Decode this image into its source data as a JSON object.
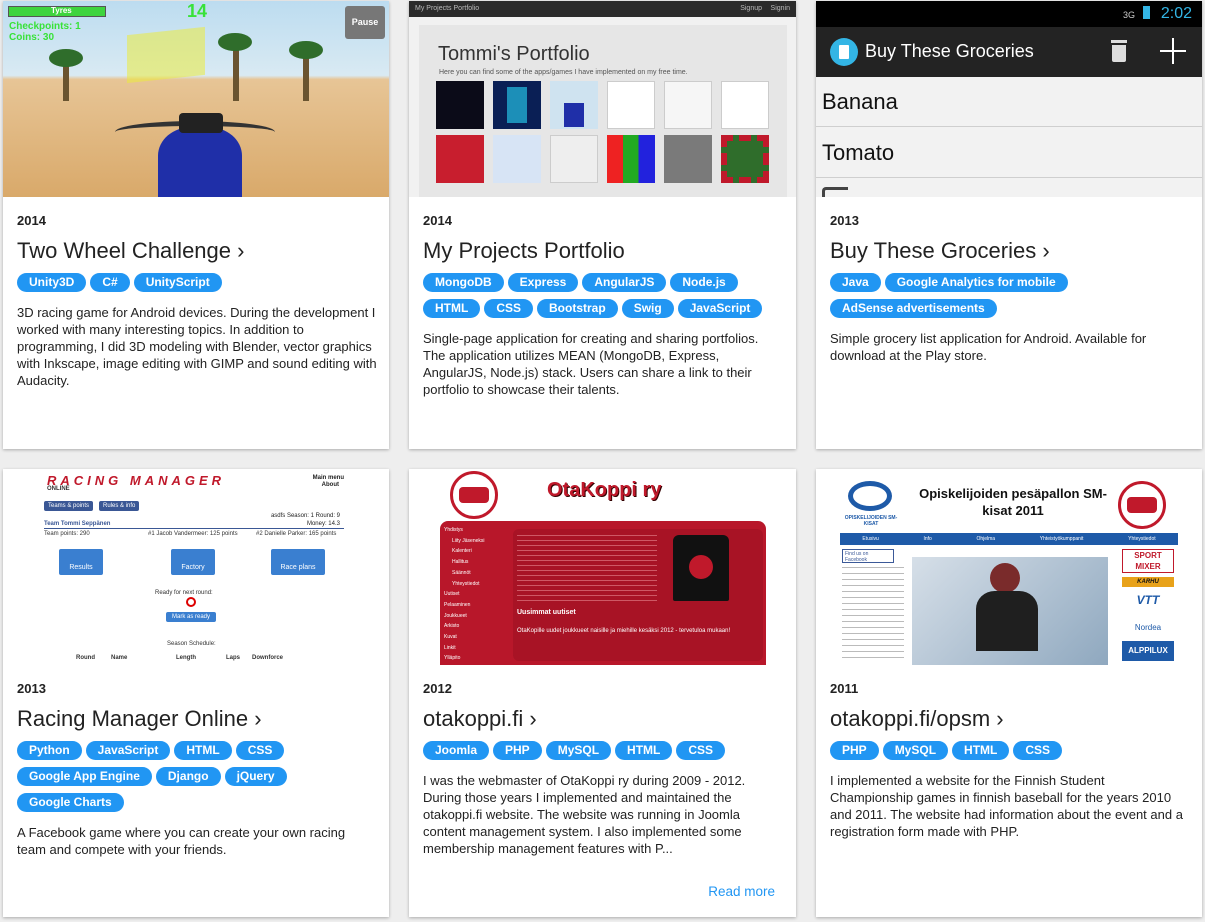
{
  "projects": [
    {
      "year": "2014",
      "title": "Two Wheel Challenge ›",
      "tags": [
        "Unity3D",
        "C#",
        "UnityScript"
      ],
      "description": "3D racing game for Android devices. During the development I worked with many interesting topics. In addition to programming, I did 3D modeling with Blender, vector graphics with Inkscape, image editing with GIMP and sound editing with Audacity.",
      "thumb": {
        "hud_tyres": "Tyres",
        "hud_checkpoints": "Checkpoints: 1",
        "hud_coins": "Coins: 30",
        "hud_counter": "14",
        "pause_label": "Pause"
      }
    },
    {
      "year": "2014",
      "title": "My Projects Portfolio",
      "tags": [
        "MongoDB",
        "Express",
        "AngularJS",
        "Node.js",
        "HTML",
        "CSS",
        "Bootstrap",
        "Swig",
        "JavaScript"
      ],
      "description": "Single-page application for creating and sharing portfolios. The application utilizes MEAN (MongoDB, Express, AngularJS, Node.js) stack. Users can share a link to their portfolio to showcase their talents.",
      "thumb": {
        "nav_title": "My Projects Portfolio",
        "nav_signup": "Signup",
        "nav_signin": "Signin",
        "heading": "Tommi's Portfolio",
        "subheading": "Here you can find some of the apps/games I have implemented on my free time."
      }
    },
    {
      "year": "2013",
      "title": "Buy These Groceries ›",
      "tags": [
        "Java",
        "Google Analytics for mobile",
        "AdSense advertisements"
      ],
      "description": "Simple grocery list application for Android. Available for download at the Play store.",
      "thumb": {
        "clock": "2:02",
        "network": "3G",
        "app_title": "Buy These Groceries",
        "items": [
          "Banana",
          "Tomato"
        ]
      }
    },
    {
      "year": "2013",
      "title": "Racing Manager Online ›",
      "tags": [
        "Python",
        "JavaScript",
        "HTML",
        "CSS",
        "Google App Engine",
        "Django",
        "jQuery",
        "Google Charts"
      ],
      "description": "A Facebook game where you can create your own racing team and compete with your friends.",
      "thumb": {
        "logo": "RACING MANAGER",
        "logo_sub": "ONLINE",
        "menu_main": "Main menu",
        "menu_about": "About",
        "btn_teams": "Teams & points",
        "btn_rules": "Rules & info",
        "season_info": "asdfs Season: 1 Round: 9",
        "money": "Money: 14.3",
        "team_name": "Team Tommi Seppänen",
        "team_points": "Team points: 290",
        "driver1": "#1 Jacob Vandermeer: 125 points",
        "driver2": "#2 Danielle Parker: 165 points",
        "btn_results": "Results",
        "btn_factory": "Factory",
        "btn_raceplans": "Race plans",
        "ready_text": "Ready for next round:",
        "btn_ready": "Mark as ready",
        "schedule_title": "Season Schedule:",
        "schedule_cols": [
          "Round",
          "Name",
          "Length",
          "Laps",
          "Downforce"
        ]
      }
    },
    {
      "year": "2012",
      "title": "otakoppi.fi ›",
      "tags": [
        "Joomla",
        "PHP",
        "MySQL",
        "HTML",
        "CSS"
      ],
      "description": "I was the webmaster of OtaKoppi ry during 2009 - 2012. During those years I implemented and maintained the otakoppi.fi website. The website was running in Joomla content management system. I also implemented some membership management features with P...",
      "read_more": "Read more",
      "thumb": {
        "banner": "OtaKoppi ry",
        "menu": [
          "Yhdistys",
          "Liity Jäseneksi",
          "Kalenteri",
          "Hallitus",
          "Säännöt",
          "Yhteystiedot",
          "Uutiset",
          "Pelaaminen",
          "Joukkueet",
          "Arkisto",
          "Kuvat",
          "Linkit",
          "Ylläpito"
        ],
        "news_title": "Uusimmat uutiset",
        "news_headline": "OtaKopille uudet joukkueet naisille ja miehille kesäksi 2012 - tervetuloa mukaan!"
      }
    },
    {
      "year": "2011",
      "title": "otakoppi.fi/opsm ›",
      "tags": [
        "PHP",
        "MySQL",
        "HTML",
        "CSS"
      ],
      "description": "I implemented a website for the Finnish Student Championship games in finnish baseball for the years 2010 and 2011. The website had information about the event and a registration form made with PHP.",
      "thumb": {
        "heading": "Opiskelijoiden pesäpallon SM-kisat 2011",
        "logo_text": "OPISKELIJOIDEN SM-KISAT",
        "nav": [
          "Etusivu",
          "Info",
          "Ohjelma",
          "Yhteistyökumppanit",
          "Yhteystiedot"
        ],
        "facebook": "Find us on Facebook",
        "sponsors": [
          "SPORT MIXER",
          "KARHU",
          "VTT",
          "Nordea",
          "ALPPILUX"
        ]
      }
    }
  ],
  "colors": {
    "accent": "#2196f3",
    "otakoppi_red": "#c0192b",
    "statusbar_blue": "#33b5e5"
  }
}
